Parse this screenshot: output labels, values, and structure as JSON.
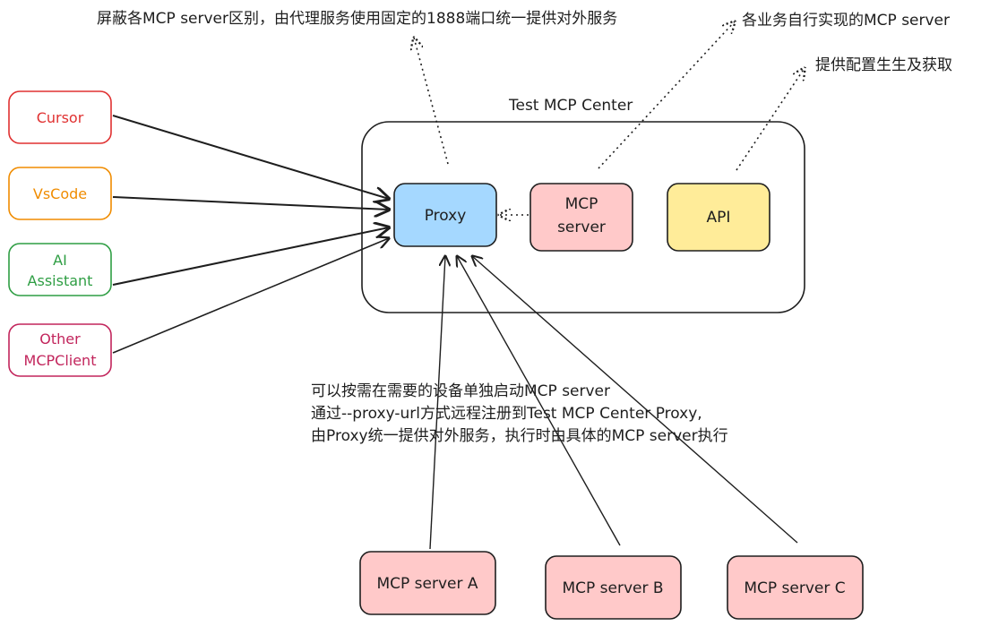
{
  "diagram": {
    "container_title": "Test MCP Center",
    "clients": [
      {
        "label_lines": [
          "Cursor"
        ],
        "color": "#e03131"
      },
      {
        "label_lines": [
          "VsCode"
        ],
        "color": "#f08c00"
      },
      {
        "label_lines": [
          "AI",
          "Assistant"
        ],
        "color": "#2f9e44"
      },
      {
        "label_lines": [
          "Other",
          "MCPClient"
        ],
        "color": "#c2255c"
      }
    ],
    "center_nodes": {
      "proxy": {
        "label": "Proxy",
        "fill": "#a5d8ff"
      },
      "mcp_server": {
        "label_lines": [
          "MCP",
          "server"
        ],
        "fill": "#ffc9c9"
      },
      "api": {
        "label": "API",
        "fill": "#ffec99"
      }
    },
    "bottom_servers": [
      {
        "label": "MCP server A"
      },
      {
        "label": "MCP server B"
      },
      {
        "label": "MCP server C"
      }
    ],
    "annotations": {
      "proxy_note": "屏蔽各MCP server区别，由代理服务使用固定的1888端口统一提供对外服务",
      "mcp_server_note": "各业务自行实现的MCP server",
      "api_note": "提供配置生生及获取",
      "register_note": [
        "可以按需在需要的设备单独启动MCP server",
        "通过--proxy-url方式远程注册到Test MCP Center Proxy,",
        "由Proxy统一提供对外服务，执行时由具体的MCP server执行"
      ]
    },
    "colors": {
      "stroke": "#1e1e1e",
      "server_fill": "#ffc9c9"
    }
  }
}
